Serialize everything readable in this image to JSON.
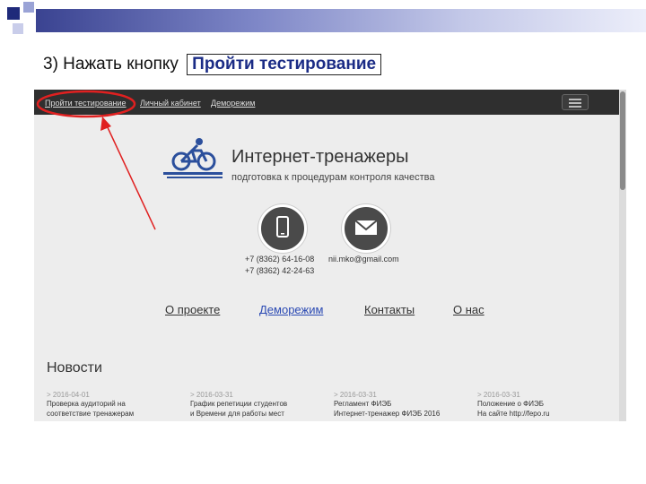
{
  "instruction": {
    "prefix": "3) Нажать кнопку",
    "button_label": "Пройти тестирование"
  },
  "site": {
    "nav": {
      "item1": "Пройти тестирование",
      "item2": "Личный кабинет",
      "item3": "Деморежим"
    },
    "brand": {
      "title": "Интернет-тренажеры",
      "tagline": "подготовка к процедурам контроля качества"
    },
    "contacts": {
      "phone1": "+7 (8362) 64-16-08",
      "phone2": "+7 (8362) 42-24-63",
      "email": "nii.mko@gmail.com"
    },
    "links": {
      "about": "О проекте",
      "demo": "Деморежим",
      "contacts": "Контакты",
      "us": "О нас"
    },
    "news": {
      "title": "Новости",
      "items": [
        {
          "date": "> 2016-04-01",
          "line1": "Проверка аудиторий на",
          "line2": "соответствие тренажерам"
        },
        {
          "date": "> 2016-03-31",
          "line1": "График репетиции студентов",
          "line2": "и Времени для работы мест"
        },
        {
          "date": "> 2016-03-31",
          "line1": "Регламент ФИЭБ",
          "line2": "Интернет-тренажер ФИЭБ 2016"
        },
        {
          "date": "> 2016-03-31",
          "line1": "Положение о ФИЭБ",
          "line2": "На сайте http://fepo.ru"
        }
      ]
    }
  },
  "icons": {
    "phone": "phone-icon",
    "mail": "mail-icon",
    "logo": "cyclist-logo-icon",
    "menu": "hamburger-menu-icon"
  },
  "colors": {
    "highlight": "#e02020",
    "link_active": "#2a49b3",
    "nav_bg": "#2f2f2f"
  }
}
